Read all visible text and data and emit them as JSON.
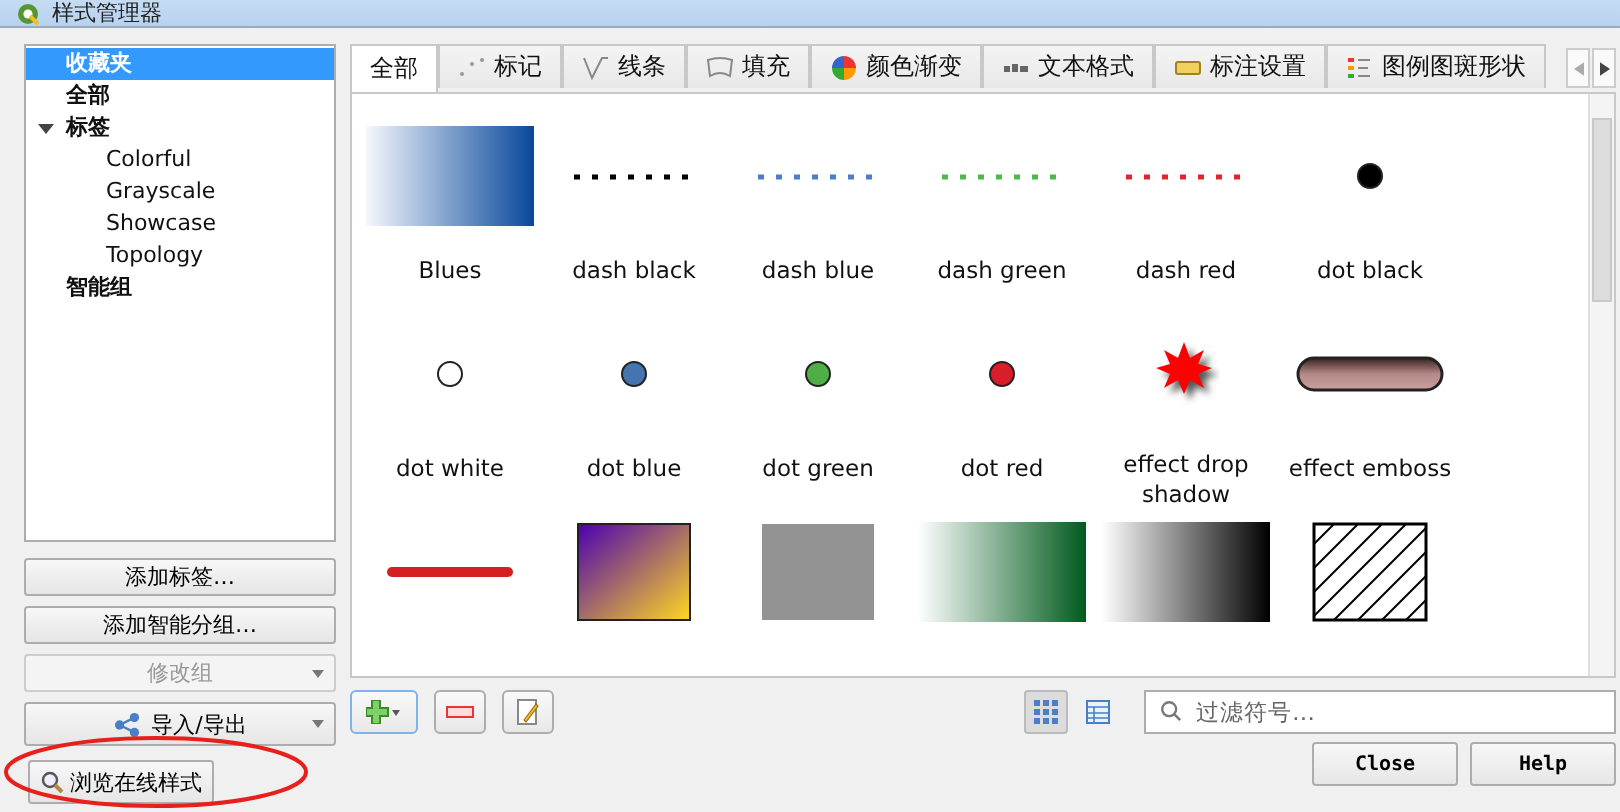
{
  "window": {
    "title": "样式管理器"
  },
  "tree": [
    {
      "label": "收藏夹",
      "selected": true
    },
    {
      "label": "全部",
      "selected": false
    },
    {
      "label": "标签",
      "selected": false,
      "expanded": true,
      "children": [
        {
          "label": "Colorful",
          "selected": false
        },
        {
          "label": "Grayscale",
          "selected": false
        },
        {
          "label": "Showcase",
          "selected": false
        },
        {
          "label": "Topology",
          "selected": false
        }
      ]
    },
    {
      "label": "智能组",
      "selected": false
    }
  ],
  "left_buttons": [
    {
      "label": "添加标签…",
      "disabled": false,
      "dropdown": false
    },
    {
      "label": "添加智能分组…",
      "disabled": false,
      "dropdown": false
    },
    {
      "label": "修改组",
      "disabled": true,
      "dropdown": true
    },
    {
      "label": "导入/导出",
      "disabled": false,
      "dropdown": true
    }
  ],
  "browse_button": {
    "label": "浏览在线样式"
  },
  "tabs": [
    {
      "label": "全部",
      "selected": true
    },
    {
      "label": "标记",
      "selected": false
    },
    {
      "label": "线条",
      "selected": false
    },
    {
      "label": "填充",
      "selected": false
    },
    {
      "label": "颜色渐变",
      "selected": false
    },
    {
      "label": "文本格式",
      "selected": false
    },
    {
      "label": "标注设置",
      "selected": false
    },
    {
      "label": "图例图斑形状",
      "selected": false
    }
  ],
  "symbols": [
    {
      "name": "Blues",
      "kind": "gradient"
    },
    {
      "name": "dash  black",
      "kind": "dashline",
      "color": "#000000"
    },
    {
      "name": "dash blue",
      "kind": "dashline",
      "color": "#4a7fc8"
    },
    {
      "name": "dash green",
      "kind": "dashline",
      "color": "#4fb84a"
    },
    {
      "name": "dash red",
      "kind": "dashline",
      "color": "#e3262e"
    },
    {
      "name": "dot  black",
      "kind": "dot",
      "color": "#000000"
    },
    {
      "name": "dot  white",
      "kind": "dot",
      "color": "#ffffff"
    },
    {
      "name": "dot blue",
      "kind": "dot",
      "color": "#4674b0"
    },
    {
      "name": "dot green",
      "kind": "dot",
      "color": "#4fae48"
    },
    {
      "name": "dot red",
      "kind": "dot",
      "color": "#d81e2a"
    },
    {
      "name": "effect drop shadow",
      "kind": "star"
    },
    {
      "name": "effect emboss",
      "kind": "emboss"
    },
    {
      "kind": "glowline"
    },
    {
      "kind": "fillgradient"
    },
    {
      "kind": "fill"
    },
    {
      "kind": "gradient"
    },
    {
      "kind": "gradient"
    },
    {
      "kind": "hatch"
    }
  ],
  "view_buttons": [
    {
      "selected": true
    },
    {
      "selected": false
    }
  ],
  "search": {
    "placeholder": "过滤符号…"
  },
  "dialog_buttons": [
    "Close",
    "Help"
  ]
}
